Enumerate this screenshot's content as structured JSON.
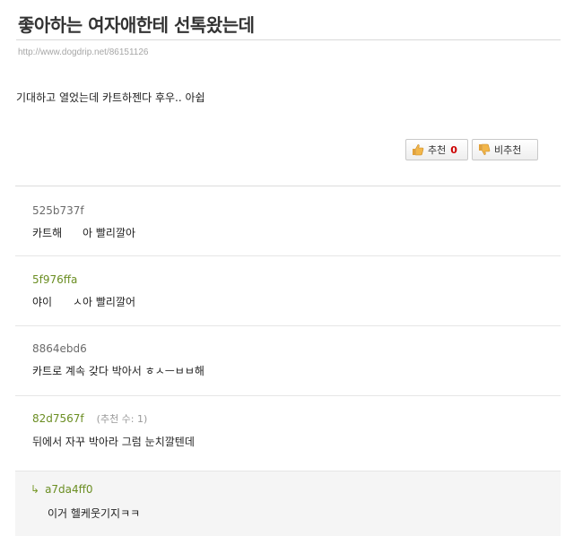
{
  "post": {
    "title": "좋아하는 여자애한테 선톡왔는데",
    "url": "http://www.dogdrip.net/86151126",
    "body": "기대하고 열었는데 카트하젠다 후우.. 아쉽"
  },
  "votes": {
    "up_label": "추천",
    "up_count": "0",
    "down_label": "비추천"
  },
  "comments": [
    {
      "author": "525b737f",
      "text": "카트해      아 빨리깔아"
    },
    {
      "author": "5f976ffa",
      "text": "야이      ㅅ아 빨리깔어"
    },
    {
      "author": "8864ebd6",
      "text": "카트로 계속 갖다 박아서 ㅎㅅㅡㅂㅂ해"
    },
    {
      "author": "82d7567f",
      "votes": "(추천 수: 1)",
      "text": "뒤에서 자꾸 박아라 그럼 눈치깔텐데"
    }
  ],
  "reply": {
    "arrow": "↳",
    "author": "a7da4ff0",
    "text": "이거 헬케웃기지ㅋㅋ"
  },
  "colors": {
    "up_count": "#cc0000",
    "author_green": "#6b8e23"
  }
}
